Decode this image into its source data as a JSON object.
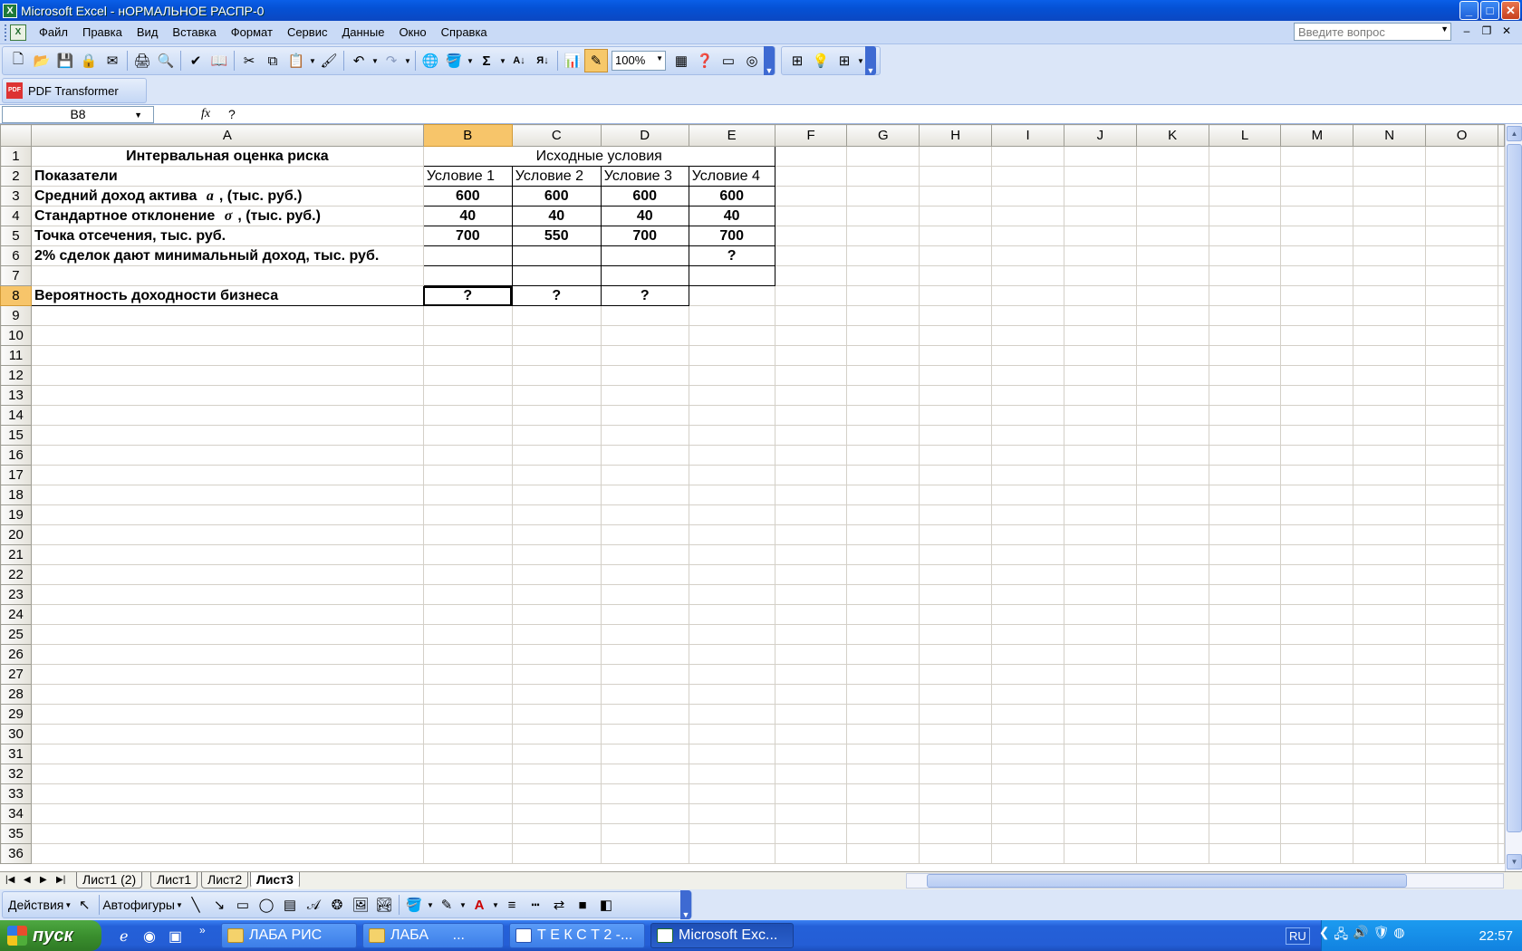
{
  "window": {
    "title": "Microsoft Excel - нОРМАЛЬНОЕ РАСПР-0",
    "min": "_",
    "max": "□",
    "close": "✕"
  },
  "menu": {
    "items": [
      "Файл",
      "Правка",
      "Вид",
      "Вставка",
      "Формат",
      "Сервис",
      "Данные",
      "Окно",
      "Справка"
    ],
    "help_placeholder": "Введите вопрос"
  },
  "toolbar": {
    "zoom": "100%"
  },
  "pdf_toolbar": {
    "label": "PDF Transformer",
    "icon": "PDF"
  },
  "formula_bar": {
    "name_box": "B8",
    "fx": "fx",
    "content": "?"
  },
  "sheet": {
    "columns": [
      "A",
      "B",
      "C",
      "D",
      "E",
      "F",
      "G",
      "H",
      "I",
      "J",
      "K",
      "L",
      "M",
      "N",
      "O"
    ],
    "selected_col": "B",
    "selected_row": 8,
    "row_count": 36,
    "cells": {
      "A1": "Интервальная оценка риска",
      "B1": "Исходные условия",
      "A2": "Показатели",
      "B2": "Условие 1",
      "C2": "Условие 2",
      "D2": "Условие 3",
      "E2": "Условие 4",
      "A3": "Средний доход актива",
      "A3_sym": "a",
      "A3_suffix": ", (тыс. руб.)",
      "B3": "600",
      "C3": "600",
      "D3": "600",
      "E3": "600",
      "A4": "Стандартное отклонение",
      "A4_sym": "σ",
      "A4_suffix": ", (тыс. руб.)",
      "B4": "40",
      "C4": "40",
      "D4": "40",
      "E4": "40",
      "A5": "Точка отсечения, тыс. руб.",
      "B5": "700",
      "C5": "550",
      "D5": "700",
      "E5": "700",
      "A6": "2% сделок дают минимальный доход, тыс. руб.",
      "E6": "?",
      "A8": "Вероятность доходности бизнеса",
      "B8": "?",
      "C8": "?",
      "D8": "?"
    }
  },
  "sheet_tabs": [
    "Лист1 (2)",
    "Лист1",
    "Лист2",
    "Лист3"
  ],
  "active_tab": "Лист3",
  "draw_toolbar": {
    "actions": "Действия",
    "autoshapes": "Автофигуры"
  },
  "taskbar": {
    "start": "пуск",
    "tasks": [
      "ЛАБА РИС",
      "ЛАБА      ...",
      "Т Е К С Т 2 -...",
      "Microsoft Exc..."
    ],
    "lang": "RU",
    "clock": "22:57"
  }
}
